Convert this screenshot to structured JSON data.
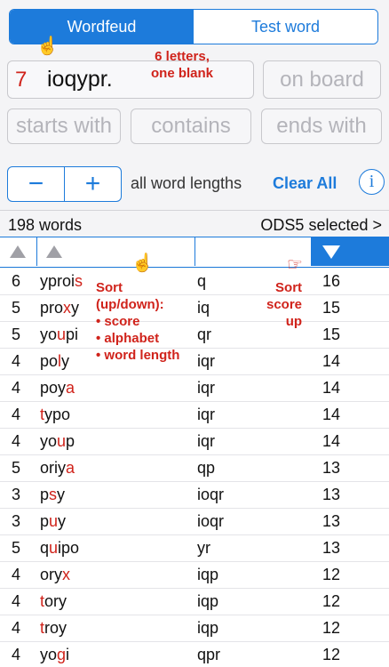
{
  "tabs": {
    "left": "Wordfeud",
    "right": "Test word"
  },
  "rack": {
    "count": "7",
    "letters": "ioqypr."
  },
  "fields": {
    "on_board": "on board",
    "starts_with": "starts with",
    "contains": "contains",
    "ends_with": "ends with"
  },
  "stepper": {
    "minus": "−",
    "plus": "+"
  },
  "lengths_label": "all word lengths",
  "clear_all": "Clear All",
  "info": "i",
  "summary": {
    "word_count": "198 words",
    "dictionary": "ODS5 selected >"
  },
  "annotations": {
    "letters": "6 letters,\none blank",
    "sort_help": "Sort\n(up/down):\n• score\n• alphabet\n• word length",
    "sort_score": "Sort\nscore\nup"
  },
  "icons": {
    "hand_pointer": "pointing-hand-icon",
    "sort_up": "triangle-up-icon",
    "sort_down": "triangle-down-icon",
    "chevron": "chevron-right-icon",
    "info": "info-icon"
  },
  "colors": {
    "accent": "#1d7bdb",
    "highlight": "#d0231b",
    "placeholder": "#b4b4ba"
  },
  "rows": [
    {
      "len": "6",
      "word": [
        "ypro",
        "i",
        "s"
      ],
      "hl": [
        false,
        false,
        true
      ],
      "rack": "q",
      "score": "16"
    },
    {
      "len": "5",
      "word": [
        "pro",
        "x",
        "y"
      ],
      "hl": [
        false,
        true,
        false
      ],
      "rack": "iq",
      "score": "15"
    },
    {
      "len": "5",
      "word": [
        "yo",
        "u",
        "pi"
      ],
      "hl": [
        false,
        true,
        false
      ],
      "rack": "qr",
      "score": "15"
    },
    {
      "len": "4",
      "word": [
        "po",
        "l",
        "y"
      ],
      "hl": [
        false,
        true,
        false
      ],
      "rack": "iqr",
      "score": "14"
    },
    {
      "len": "4",
      "word": [
        "poy",
        "a"
      ],
      "hl": [
        false,
        true
      ],
      "rack": "iqr",
      "score": "14"
    },
    {
      "len": "4",
      "word": [
        "t",
        "ypo"
      ],
      "hl": [
        true,
        false
      ],
      "rack": "iqr",
      "score": "14"
    },
    {
      "len": "4",
      "word": [
        "yo",
        "u",
        "p"
      ],
      "hl": [
        false,
        true,
        false
      ],
      "rack": "iqr",
      "score": "14"
    },
    {
      "len": "5",
      "word": [
        "oriy",
        "a"
      ],
      "hl": [
        false,
        true
      ],
      "rack": "qp",
      "score": "13"
    },
    {
      "len": "3",
      "word": [
        "p",
        "s",
        "y"
      ],
      "hl": [
        false,
        true,
        false
      ],
      "rack": "ioqr",
      "score": "13"
    },
    {
      "len": "3",
      "word": [
        "p",
        "u",
        "y"
      ],
      "hl": [
        false,
        true,
        false
      ],
      "rack": "ioqr",
      "score": "13"
    },
    {
      "len": "5",
      "word": [
        "q",
        "u",
        "ipo"
      ],
      "hl": [
        false,
        true,
        false
      ],
      "rack": "yr",
      "score": "13"
    },
    {
      "len": "4",
      "word": [
        "ory",
        "x"
      ],
      "hl": [
        false,
        true
      ],
      "rack": "iqp",
      "score": "12"
    },
    {
      "len": "4",
      "word": [
        "t",
        "ory"
      ],
      "hl": [
        true,
        false
      ],
      "rack": "iqp",
      "score": "12"
    },
    {
      "len": "4",
      "word": [
        "t",
        "roy"
      ],
      "hl": [
        true,
        false
      ],
      "rack": "iqp",
      "score": "12"
    },
    {
      "len": "4",
      "word": [
        "yo",
        "g",
        "i"
      ],
      "hl": [
        false,
        true,
        false
      ],
      "rack": "qpr",
      "score": "12"
    }
  ]
}
